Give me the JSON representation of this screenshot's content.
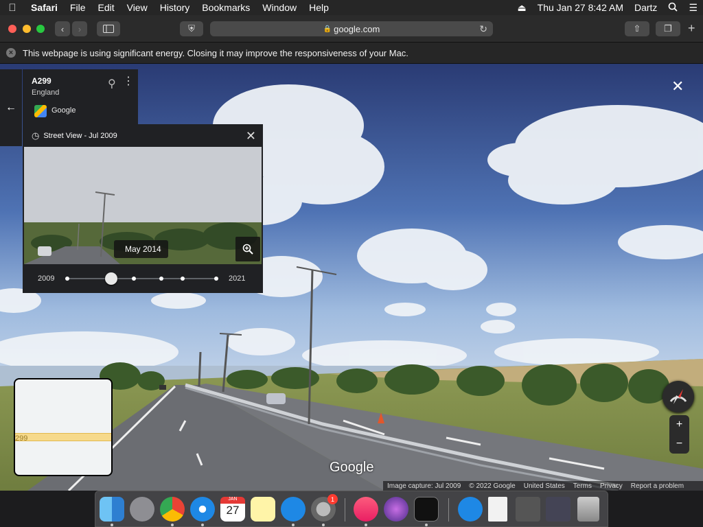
{
  "menubar": {
    "apple": "",
    "items": [
      "Safari",
      "File",
      "Edit",
      "View",
      "History",
      "Bookmarks",
      "Window",
      "Help"
    ],
    "clock": "Thu Jan 27  8:42 AM",
    "user": "Dartz"
  },
  "browser": {
    "url": "google.com",
    "energy_warning": "This webpage is using significant energy. Closing it may improve the responsiveness of your Mac."
  },
  "location": {
    "title": "A299",
    "subtitle": "England",
    "provider": "Google"
  },
  "timeline": {
    "header": "Street View - Jul 2009",
    "hover_date": "May 2014",
    "start_year": "2009",
    "end_year": "2021"
  },
  "minimap": {
    "road_label": "299"
  },
  "footer": {
    "logo": "Google",
    "capture": "Image capture: Jul 2009",
    "copyright": "© 2022 Google",
    "region": "United States",
    "terms": "Terms",
    "privacy": "Privacy",
    "report": "Report a problem"
  },
  "dock": {
    "calendar_month": "JAN",
    "calendar_day": "27",
    "badge": "1"
  },
  "colors": {
    "sky_top": "#273a73",
    "sky_bottom": "#a3bfe0",
    "panel": "#202124"
  }
}
